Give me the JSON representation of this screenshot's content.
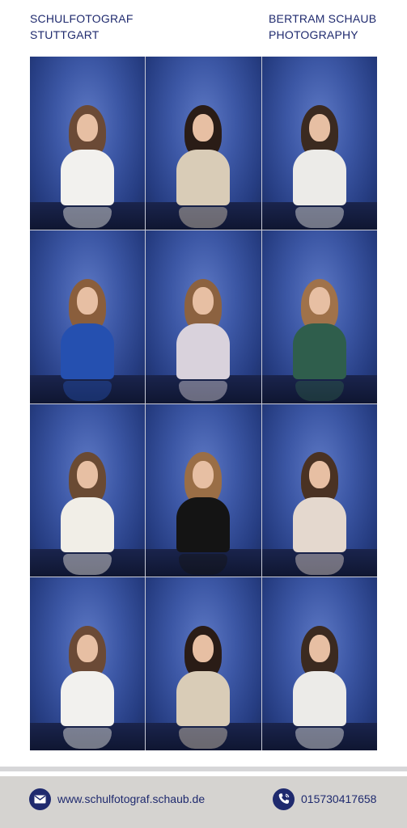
{
  "header": {
    "left_line1": "SCHULFOTOGRAF",
    "left_line2": "STUTTGART",
    "right_line1": "BERTRAM SCHAUB",
    "right_line2": "PHOTOGRAPHY"
  },
  "photos": [
    {
      "hair": "#6b4a36",
      "top": "#f2f1ee"
    },
    {
      "hair": "#2a1c16",
      "top": "#d9ccb7"
    },
    {
      "hair": "#3b2a20",
      "top": "#ecebe8"
    },
    {
      "hair": "#8a5e3c",
      "top": "#2550b0"
    },
    {
      "hair": "#8c6240",
      "top": "#d9d2dc"
    },
    {
      "hair": "#a0724a",
      "top": "#2f5e4c"
    },
    {
      "hair": "#6a4a33",
      "top": "#f1eee7"
    },
    {
      "hair": "#9a6e46",
      "top": "#141414"
    },
    {
      "hair": "#4a3223",
      "top": "#e4d8ce"
    },
    {
      "hair": "#6b4a36",
      "top": "#f2f1ee"
    },
    {
      "hair": "#2a1c16",
      "top": "#d9ccb7"
    },
    {
      "hair": "#3b2a20",
      "top": "#ecebe8"
    }
  ],
  "footer": {
    "website": "www.schulfotograf.schaub.de",
    "phone": "015730417658",
    "website_icon": "mail-icon",
    "phone_icon": "phone-icon"
  },
  "colors": {
    "brand_navy": "#1f2a6e",
    "footer_bg": "#d5d3d0"
  }
}
